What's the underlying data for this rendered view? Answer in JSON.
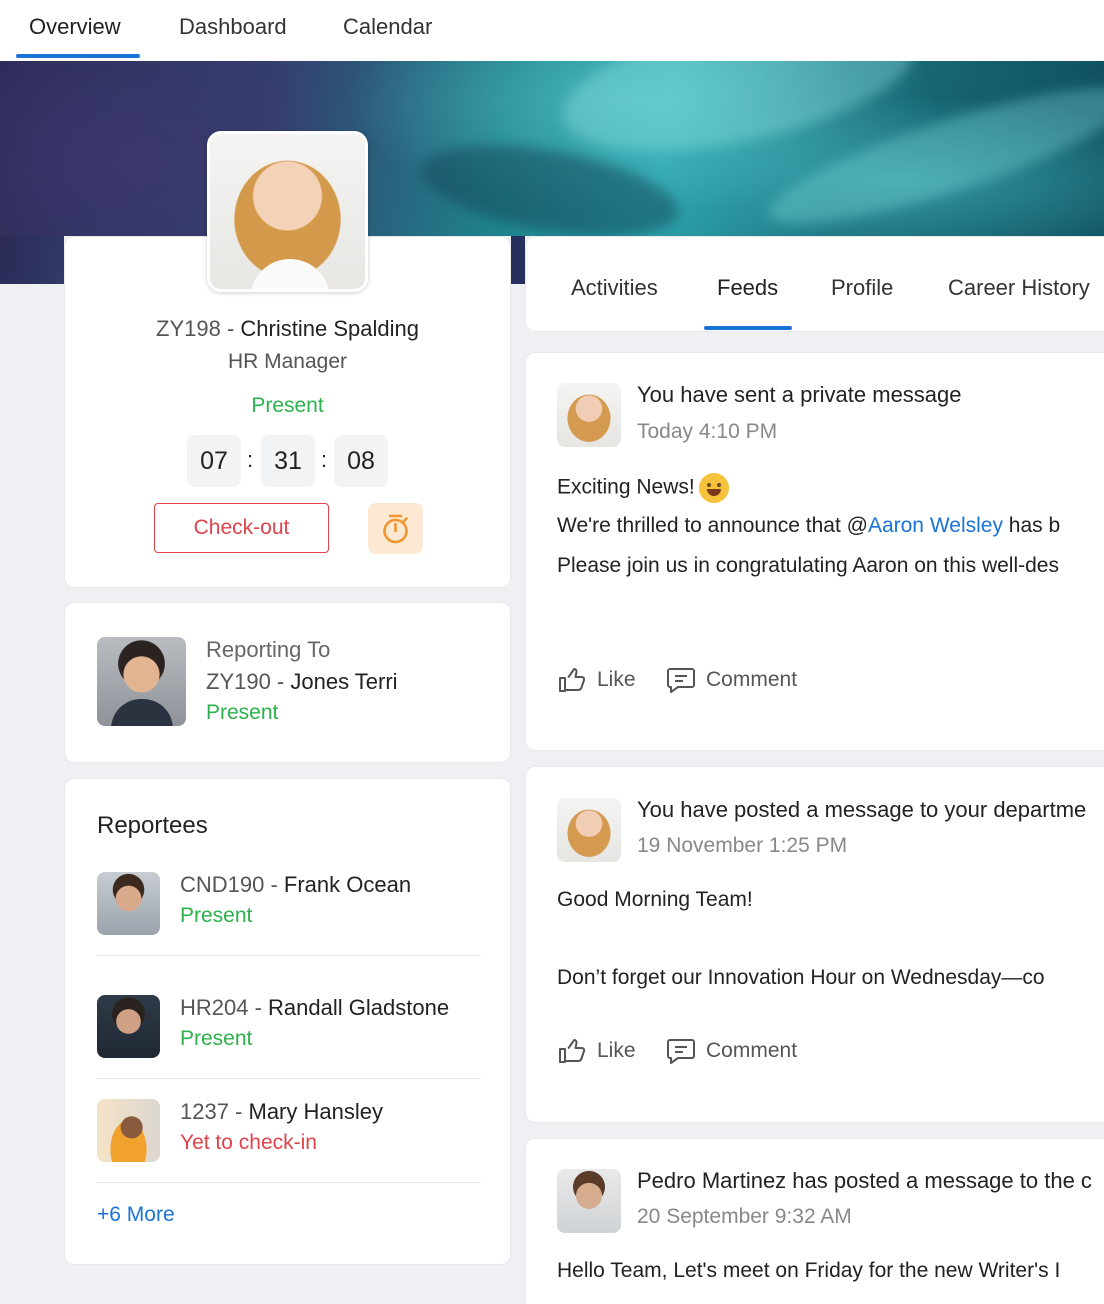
{
  "topnav": {
    "tabs": [
      "Overview",
      "Dashboard",
      "Calendar"
    ],
    "active": "Overview"
  },
  "profile": {
    "code": "ZY198 - ",
    "name": "Christine Spalding",
    "designation": "HR Manager",
    "status": "Present",
    "timer": {
      "hours": "07",
      "minutes": "31",
      "seconds": "08",
      "sep": ":"
    },
    "checkout_label": "Check-out",
    "timer_icon": "stopwatch-icon"
  },
  "reporting": {
    "label": "Reporting To",
    "code": "ZY190 - ",
    "name": "Jones Terri",
    "status": "Present"
  },
  "reportees": {
    "title": "Reportees",
    "items": [
      {
        "code": "CND190 - ",
        "name": "Frank Ocean",
        "status": "Present"
      },
      {
        "code": "HR204 - ",
        "name": "Randall Gladstone",
        "status": "Present"
      },
      {
        "code": "1237 - ",
        "name": "Mary Hansley",
        "status": "Yet to check-in"
      }
    ],
    "more_label": "+6 More"
  },
  "feed_tabs": {
    "tabs": [
      "Activities",
      "Feeds",
      "Profile",
      "Career History"
    ],
    "active": "Feeds"
  },
  "posts": [
    {
      "header": "You have sent a private message",
      "time": "Today 4:10 PM",
      "title": "Exciting News!",
      "line1_prefix": "We're thrilled to announce that @",
      "line1_mention": "Aaron Welsley",
      "line1_suffix": " has b",
      "line2": "Please join us in congratulating Aaron on this well-des",
      "like": "Like",
      "comment": "Comment"
    },
    {
      "header": "You have posted a message to your departme",
      "time": "19 November 1:25 PM",
      "line1": "Good Morning Team!",
      "line2": "Don’t forget our Innovation Hour on Wednesday—co",
      "like": "Like",
      "comment": "Comment"
    },
    {
      "header": "Pedro Martinez has posted a message to the c",
      "time": "20 September 9:32 AM",
      "line1": "Hello Team, Let's meet on Friday for the new Writer's I"
    }
  ],
  "colors": {
    "accent": "#1a73d6",
    "present": "#2bb24c",
    "absent": "#e0434b",
    "timer_bg": "#fde8d4"
  }
}
